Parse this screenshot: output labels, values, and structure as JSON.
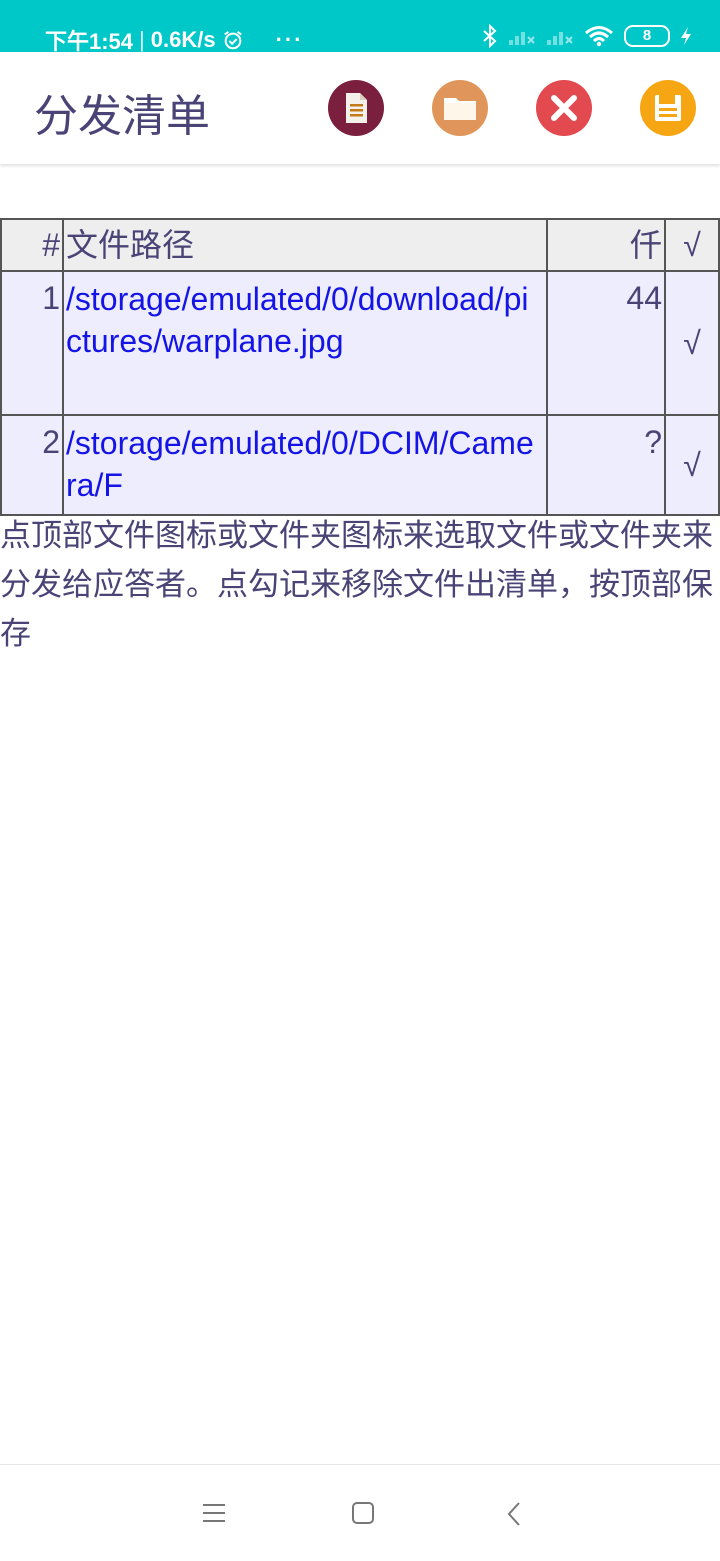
{
  "status_bar": {
    "time": "下午1:54",
    "network_speed": "0.6K/s",
    "more": "···",
    "battery_level": "8",
    "icons": [
      "alarm-icon",
      "bluetooth-icon",
      "signal-icon",
      "signal-icon",
      "wifi-icon",
      "battery-icon",
      "charging-icon"
    ]
  },
  "app_bar": {
    "title": "分发清单",
    "actions": [
      {
        "name": "file",
        "icon": "document-icon",
        "color": "#7a1f3d"
      },
      {
        "name": "folder",
        "icon": "folder-icon",
        "color": "#e0965a"
      },
      {
        "name": "clear",
        "icon": "close-icon",
        "color": "#e24a4f"
      },
      {
        "name": "save",
        "icon": "save-icon",
        "color": "#f6a613"
      }
    ]
  },
  "table": {
    "headers": {
      "index": "#",
      "path": "文件路径",
      "size": "仟",
      "check": "√"
    },
    "rows": [
      {
        "index": "1",
        "path": "/storage/emulated/0/download/pictures/warplane.jpg",
        "size": "44",
        "check": "√"
      },
      {
        "index": "2",
        "path": "/storage/emulated/0/DCIM/Camera/F",
        "size": "?",
        "check": "√"
      }
    ]
  },
  "instructions": "点顶部文件图标或文件夹图标来选取文件或文件夹来分发给应答者。点勾记来移除文件出清单，按顶部保存",
  "colors": {
    "status_bar": "#00c8c8",
    "title": "#4a4376",
    "path_link": "#1414e6",
    "row_bg": "#ededfd",
    "header_bg": "#eeeeee"
  }
}
